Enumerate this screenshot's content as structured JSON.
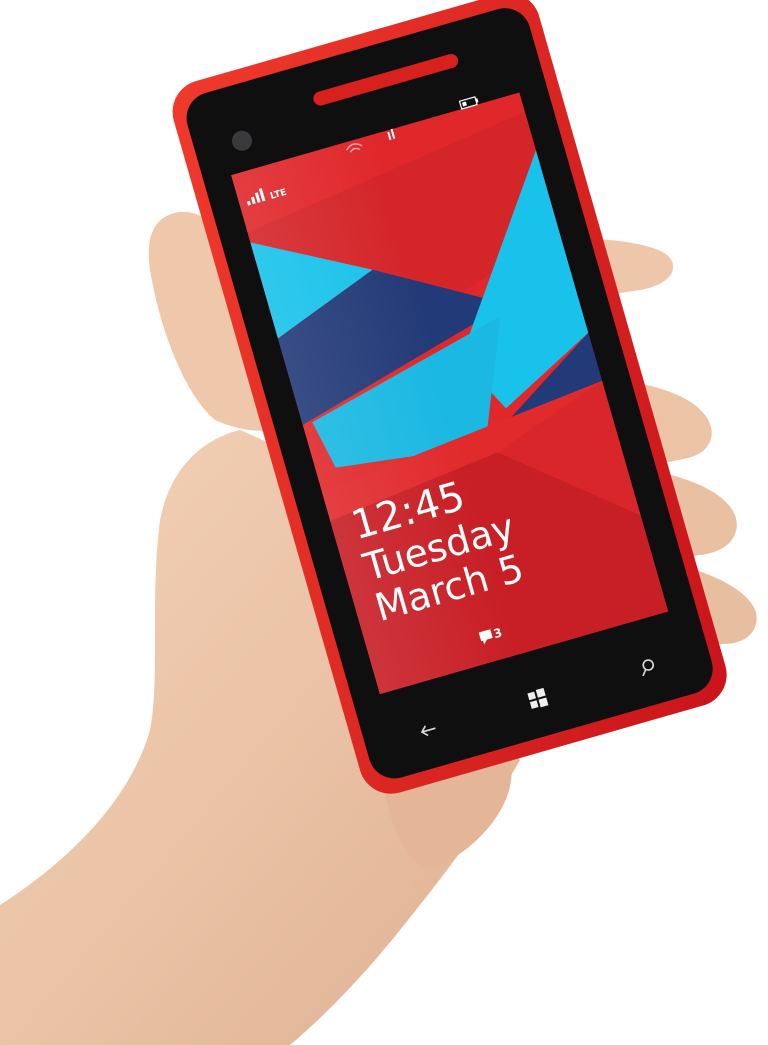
{
  "status_bar": {
    "network_label": "LTE",
    "signal_icon": "signal-bars-icon",
    "wifi_icon": "wifi-icon",
    "sync_icon": "sync-icon",
    "battery_icon": "battery-icon"
  },
  "lock_screen": {
    "time": "12:45",
    "day": "Tuesday",
    "date": "March 5",
    "message_count": "3",
    "message_icon": "message-bubble-icon"
  },
  "nav_bar": {
    "back_icon": "back-arrow-icon",
    "start_icon": "windows-logo-icon",
    "search_icon": "search-icon"
  },
  "colors": {
    "phone_body": "#e4231f",
    "screen_red": "#e0282b",
    "screen_dark_red": "#c81e25",
    "accent_cyan": "#19c2ea",
    "accent_navy": "#233a78",
    "bezel": "#111111",
    "skin": "#efc9ad"
  }
}
